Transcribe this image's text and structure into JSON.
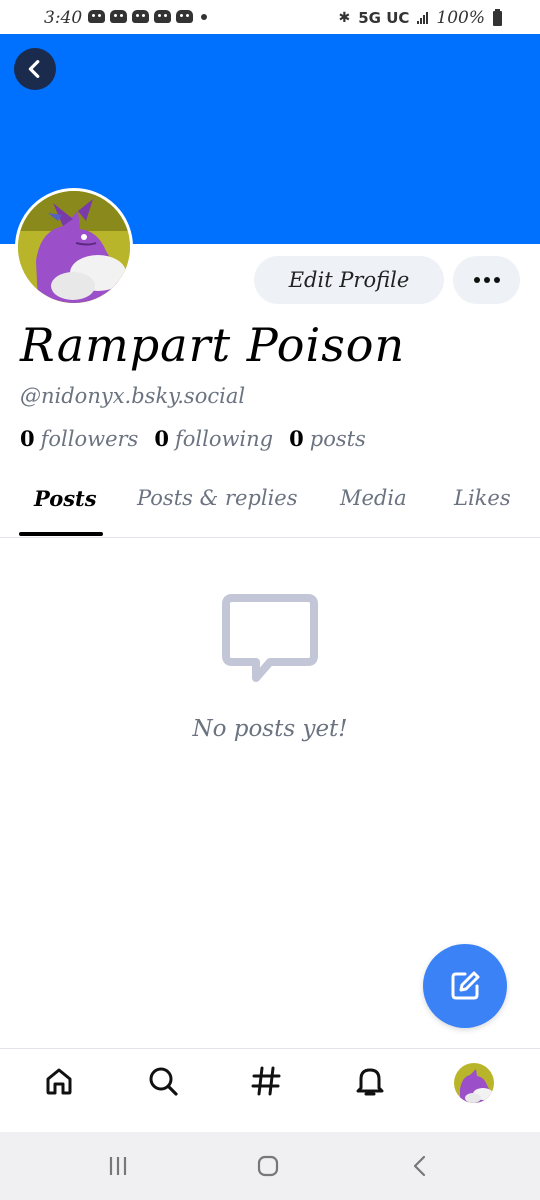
{
  "status_bar": {
    "time": "3:40",
    "network": "5G UC",
    "battery": "100%"
  },
  "profile": {
    "display_name": "Rampart Poison",
    "handle": "@nidonyx.bsky.social",
    "stats": {
      "followers_count": "0",
      "followers_label": "followers",
      "following_count": "0",
      "following_label": "following",
      "posts_count": "0",
      "posts_label": "posts"
    },
    "edit_label": "Edit Profile",
    "banner_color": "#0070ff"
  },
  "tabs": [
    {
      "label": "Posts",
      "active": true
    },
    {
      "label": "Posts & replies",
      "active": false
    },
    {
      "label": "Media",
      "active": false
    },
    {
      "label": "Likes",
      "active": false
    }
  ],
  "empty_state": {
    "icon": "message-bubble-icon",
    "text": "No posts yet!"
  },
  "fab": {
    "icon": "compose-icon",
    "color": "#3b82f6"
  },
  "bottom_nav": {
    "items": [
      "home-icon",
      "search-icon",
      "hashtag-icon",
      "bell-icon",
      "avatar"
    ]
  },
  "system_nav": {
    "items": [
      "recents-icon",
      "home-circle-icon",
      "back-chevron-icon"
    ]
  }
}
